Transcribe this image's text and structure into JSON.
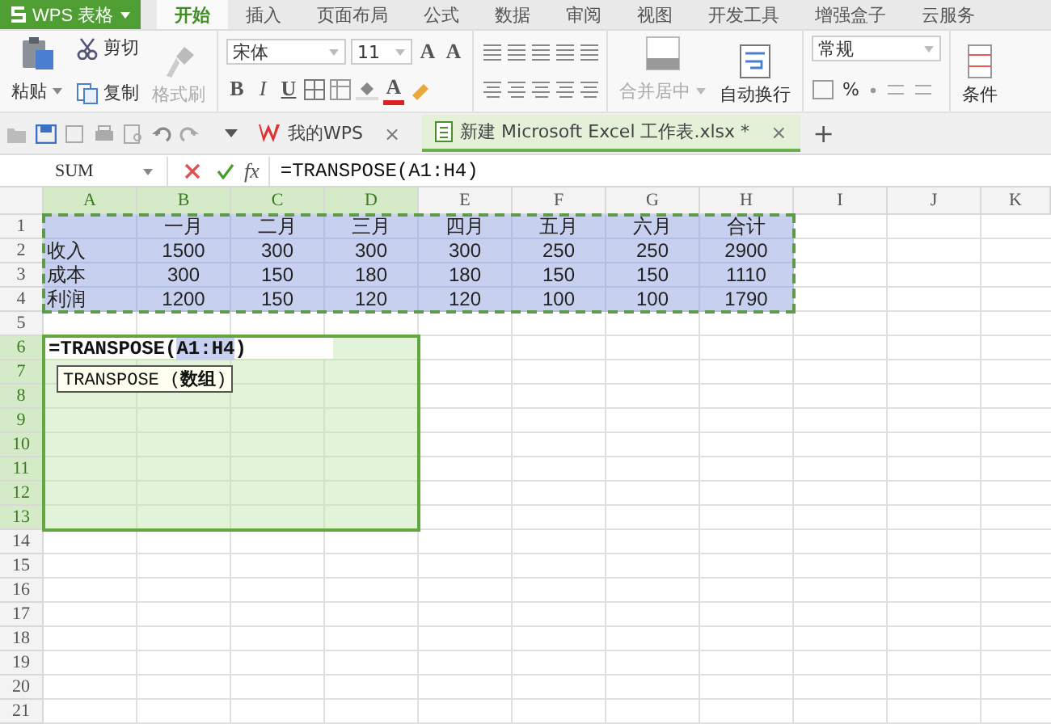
{
  "app_menu": {
    "label": "WPS 表格"
  },
  "menu_tabs": [
    {
      "label": "开始",
      "selected": true
    },
    {
      "label": "插入",
      "selected": false
    },
    {
      "label": "页面布局",
      "selected": false
    },
    {
      "label": "公式",
      "selected": false
    },
    {
      "label": "数据",
      "selected": false
    },
    {
      "label": "审阅",
      "selected": false
    },
    {
      "label": "视图",
      "selected": false
    },
    {
      "label": "开发工具",
      "selected": false
    },
    {
      "label": "增强盒子",
      "selected": false
    },
    {
      "label": "云服务",
      "selected": false
    }
  ],
  "ribbon": {
    "paste": "粘贴",
    "cut": "剪切",
    "copy": "复制",
    "format_painter": {
      "label": "格式刷",
      "disabled": true
    },
    "font_name": "宋体",
    "font_size": "11",
    "grow_font": "A",
    "shrink_font": "A",
    "bold": "B",
    "italic": "I",
    "underline": "U",
    "font_color": "A",
    "merge": {
      "label": "合并居中",
      "disabled": true
    },
    "wrap_text": "自动换行",
    "number_format": "常规",
    "percent": "%",
    "conditional_format": "条件"
  },
  "doc_tabs": [
    {
      "kind": "home",
      "label": "我的WPS",
      "close": "×",
      "selected": false
    },
    {
      "kind": "file",
      "label": "新建 Microsoft Excel 工作表.xlsx *",
      "close": "×",
      "selected": true
    }
  ],
  "new_tab": "+",
  "formula_bar": {
    "name_box": "SUM",
    "fx": "fx",
    "formula": "=TRANSPOSE(A1:H4)"
  },
  "sheet": {
    "columns": [
      {
        "label": "A",
        "selected": true,
        "referenced": true
      },
      {
        "label": "B",
        "selected": true,
        "referenced": true
      },
      {
        "label": "C",
        "selected": true,
        "referenced": true
      },
      {
        "label": "D",
        "selected": true,
        "referenced": true
      },
      {
        "label": "E",
        "selected": false,
        "referenced": true
      },
      {
        "label": "F",
        "selected": false,
        "referenced": true
      },
      {
        "label": "G",
        "selected": false,
        "referenced": true
      },
      {
        "label": "H",
        "selected": false,
        "referenced": true
      },
      {
        "label": "I",
        "selected": false
      },
      {
        "label": "J",
        "selected": false
      },
      {
        "label": "K",
        "selected": false
      }
    ],
    "rows": [
      {
        "label": "1",
        "selected": false,
        "referenced": true,
        "cells": [
          null,
          "一月",
          "二月",
          "三月",
          "四月",
          "五月",
          "六月",
          "合计"
        ]
      },
      {
        "label": "2",
        "selected": false,
        "referenced": true,
        "cells": [
          "收入",
          "1500",
          "300",
          "300",
          "300",
          "250",
          "250",
          "2900"
        ]
      },
      {
        "label": "3",
        "selected": false,
        "referenced": true,
        "cells": [
          "成本",
          "300",
          "150",
          "180",
          "180",
          "150",
          "150",
          "1110"
        ]
      },
      {
        "label": "4",
        "selected": false,
        "referenced": true,
        "cells": [
          "利润",
          "1200",
          "150",
          "120",
          "120",
          "100",
          "100",
          "1790"
        ]
      },
      {
        "label": "5",
        "selected": false
      },
      {
        "label": "6",
        "selected": true,
        "editor": {
          "parts": [
            {
              "kind": "text",
              "text": "=TRANSPOSE("
            },
            {
              "kind": "reference",
              "text": "A1:H4"
            },
            {
              "kind": "text",
              "text": ")"
            }
          ],
          "tooltip": "TRANSPOSE (**数组**)"
        }
      },
      {
        "label": "7",
        "selected": true
      },
      {
        "label": "8",
        "selected": true
      },
      {
        "label": "9",
        "selected": true
      },
      {
        "label": "10",
        "selected": true
      },
      {
        "label": "11",
        "selected": true
      },
      {
        "label": "12",
        "selected": true
      },
      {
        "label": "13",
        "selected": true
      },
      {
        "label": "14",
        "selected": false
      },
      {
        "label": "15",
        "selected": false
      },
      {
        "label": "16",
        "selected": false
      },
      {
        "label": "17",
        "selected": false
      },
      {
        "label": "18",
        "selected": false
      },
      {
        "label": "19",
        "selected": false
      },
      {
        "label": "20",
        "selected": false
      },
      {
        "label": "21",
        "selected": false
      }
    ]
  }
}
